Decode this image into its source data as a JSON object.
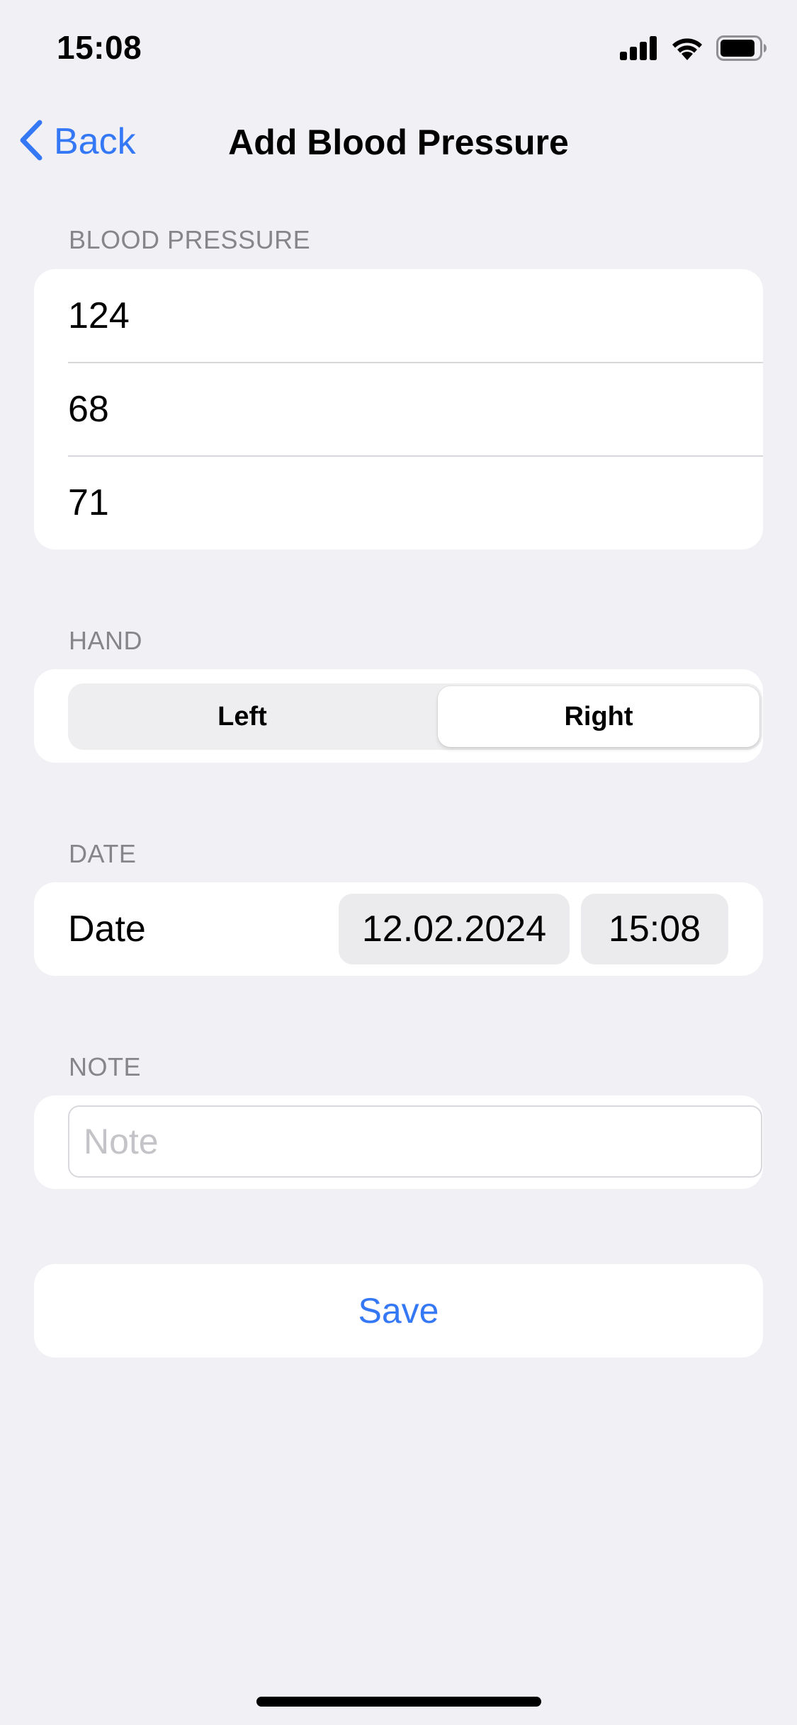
{
  "status_bar": {
    "time": "15:08",
    "icons": [
      "cellular-signal-icon",
      "wifi-icon",
      "battery-icon"
    ]
  },
  "nav": {
    "back_label": "Back",
    "title": "Add Blood Pressure"
  },
  "sections": {
    "blood_pressure": {
      "header": "BLOOD PRESSURE",
      "values": [
        "124",
        "68",
        "71"
      ]
    },
    "hand": {
      "header": "HAND",
      "options": [
        "Left",
        "Right"
      ],
      "selected": "Right"
    },
    "date": {
      "header": "DATE",
      "label": "Date",
      "date_value": "12.02.2024",
      "time_value": "15:08"
    },
    "note": {
      "header": "NOTE",
      "placeholder": "Note",
      "value": ""
    }
  },
  "actions": {
    "save_label": "Save"
  },
  "colors": {
    "accent": "#3478f6",
    "background": "#f0f0f5",
    "card": "#ffffff",
    "section_header": "#85858a"
  }
}
